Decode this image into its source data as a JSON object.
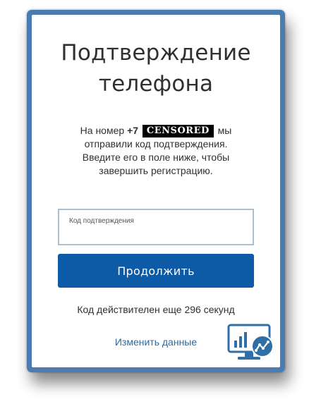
{
  "title": {
    "line1": "Подтверждение",
    "line2": "телефона"
  },
  "info": {
    "prefix": "На номер",
    "phone_prefix": "+7",
    "censored": "CENSORED",
    "suffix": "мы",
    "line2": "отправили код подтверждения.",
    "line3": "Введите его в поле ниже, чтобы",
    "line4": "завершить регистрацию."
  },
  "code_field": {
    "label": "Код подтверждения",
    "value": ""
  },
  "continue_button": {
    "label": "Продолжить"
  },
  "timer": {
    "text": "Код действителен еще 296 секунд"
  },
  "change_link": {
    "label": "Изменить данные"
  },
  "colors": {
    "frame": "#4a7bb2",
    "button": "#0d5aa6",
    "link": "#2c6aa0",
    "field_border": "#a9c0d3",
    "logo": "#2f6fa8"
  },
  "icons": {
    "logo": "monitor-chart-icon"
  }
}
